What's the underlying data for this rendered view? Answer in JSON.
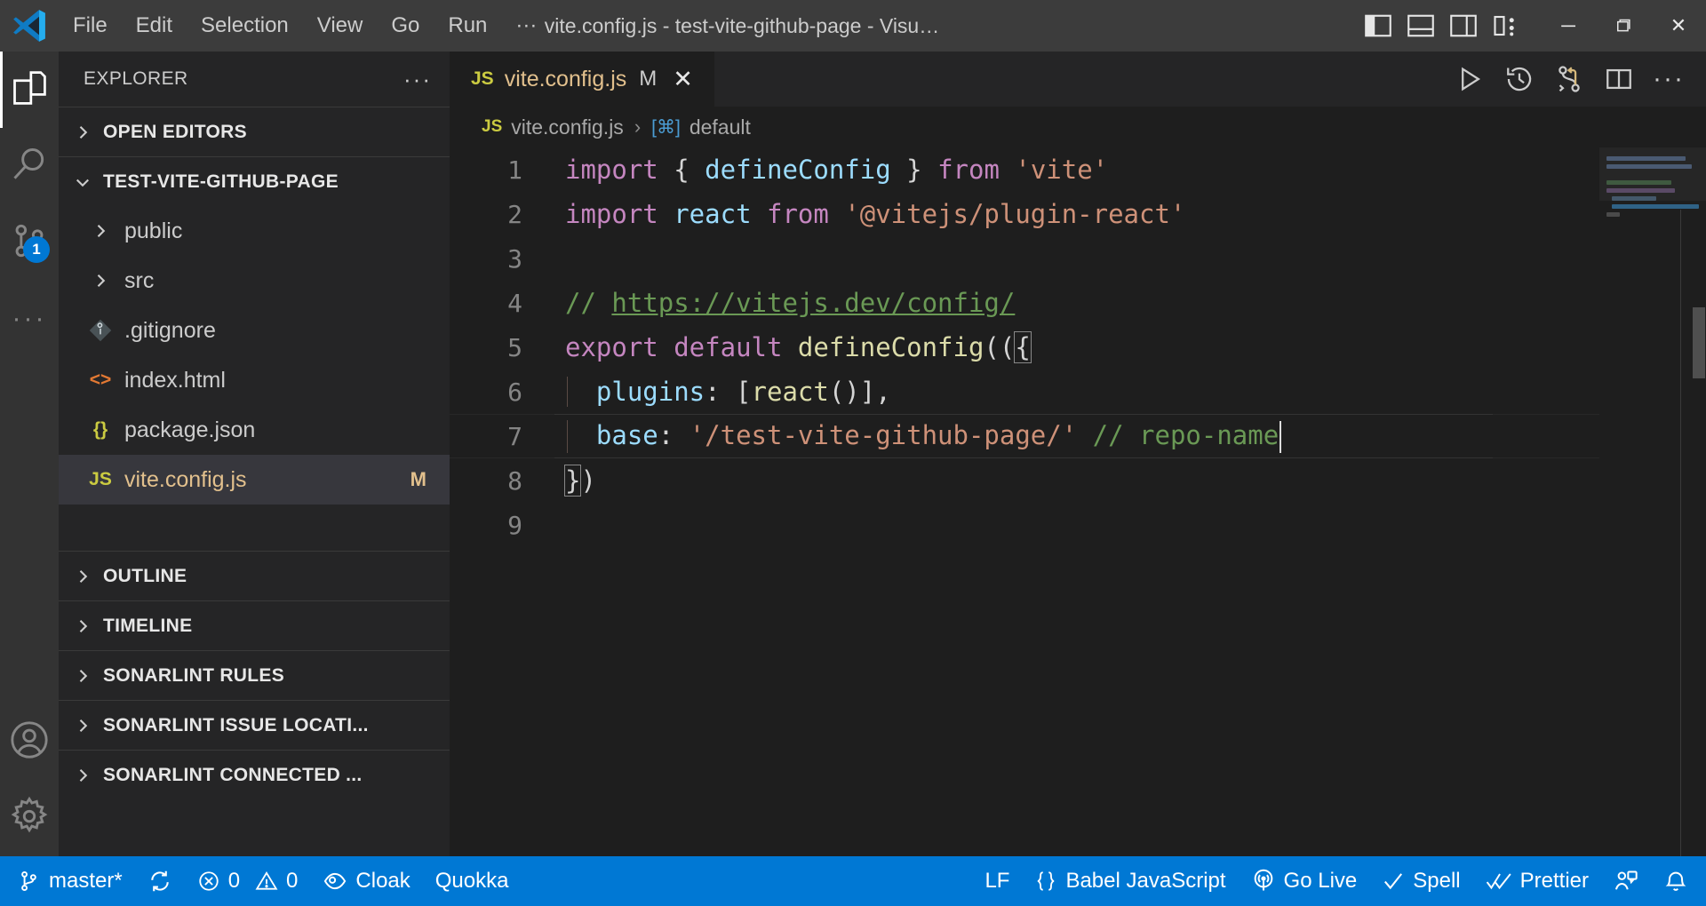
{
  "window": {
    "title": "vite.config.js - test-vite-github-page - Visu…",
    "minimize_label": "─",
    "maximize_label": "❐",
    "close_label": "✕"
  },
  "menu": {
    "items": [
      {
        "label": "File"
      },
      {
        "label": "Edit"
      },
      {
        "label": "Selection"
      },
      {
        "label": "View"
      },
      {
        "label": "Go"
      },
      {
        "label": "Run"
      },
      {
        "label": "···"
      }
    ]
  },
  "layout_buttons": [
    {
      "name": "toggle-primary-sidebar",
      "label": "Toggle Primary Side Bar"
    },
    {
      "name": "toggle-panel",
      "label": "Toggle Panel"
    },
    {
      "name": "toggle-secondary-sidebar",
      "label": "Toggle Secondary Side Bar"
    },
    {
      "name": "customize-layout",
      "label": "Customize Layout"
    }
  ],
  "activitybar": {
    "items": [
      {
        "name": "explorer",
        "label": "Explorer",
        "active": true,
        "badge": ""
      },
      {
        "name": "search",
        "label": "Search",
        "active": false,
        "badge": ""
      },
      {
        "name": "source-control",
        "label": "Source Control",
        "active": false,
        "badge": "1"
      },
      {
        "name": "more-views",
        "label": "Additional Views",
        "active": false,
        "badge": ""
      }
    ],
    "bottom_items": [
      {
        "name": "accounts",
        "label": "Accounts"
      },
      {
        "name": "manage",
        "label": "Manage"
      }
    ]
  },
  "sidebar": {
    "header": "EXPLORER",
    "header_actions": "···",
    "sections": [
      {
        "label": "OPEN EDITORS",
        "expanded": false
      },
      {
        "label": "TEST-VITE-GITHUB-PAGE",
        "expanded": true
      },
      {
        "label": "OUTLINE",
        "expanded": false
      },
      {
        "label": "TIMELINE",
        "expanded": false
      },
      {
        "label": "SONARLINT RULES",
        "expanded": false
      },
      {
        "label": "SONARLINT ISSUE LOCATI...",
        "expanded": false
      },
      {
        "label": "SONARLINT CONNECTED ...",
        "expanded": false
      }
    ],
    "tree": [
      {
        "name": "public",
        "type": "folder",
        "icon": "chevron-right-icon",
        "icon_text": "",
        "badge": "",
        "selected": false
      },
      {
        "name": "src",
        "type": "folder",
        "icon": "chevron-right-icon",
        "icon_text": "",
        "badge": "",
        "selected": false
      },
      {
        "name": ".gitignore",
        "type": "file",
        "icon": "git-icon",
        "icon_text": "◆",
        "badge": "",
        "selected": false
      },
      {
        "name": "index.html",
        "type": "file",
        "icon": "html-icon",
        "icon_text": "<>",
        "badge": "",
        "selected": false
      },
      {
        "name": "package.json",
        "type": "file",
        "icon": "json-icon",
        "icon_text": "{}",
        "badge": "",
        "selected": false
      },
      {
        "name": "vite.config.js",
        "type": "file",
        "icon": "js-icon",
        "icon_text": "JS",
        "badge": "M",
        "selected": true
      }
    ]
  },
  "editor": {
    "tab": {
      "icon_text": "JS",
      "label": "vite.config.js",
      "modified_badge": "M",
      "close_label": "✕"
    },
    "actions": [
      {
        "name": "run-code",
        "label": "Run Code"
      },
      {
        "name": "timeline-history",
        "label": "Open Timeline"
      },
      {
        "name": "compare-changes",
        "label": "Open Changes"
      },
      {
        "name": "split-editor",
        "label": "Split Editor Right"
      },
      {
        "name": "more-actions",
        "label": "More Actions..."
      }
    ],
    "breadcrumb": {
      "file_icon_text": "JS",
      "file": "vite.config.js",
      "separator": "›",
      "symbol_icon": "[⌘]",
      "symbol": "default"
    },
    "lines": [
      {
        "n": "1",
        "modified": false,
        "current": false
      },
      {
        "n": "2",
        "modified": false,
        "current": false
      },
      {
        "n": "3",
        "modified": false,
        "current": false
      },
      {
        "n": "4",
        "modified": false,
        "current": false
      },
      {
        "n": "5",
        "modified": false,
        "current": false
      },
      {
        "n": "6",
        "modified": true,
        "current": false
      },
      {
        "n": "7",
        "modified": true,
        "current": true
      },
      {
        "n": "8",
        "modified": false,
        "current": false
      },
      {
        "n": "9",
        "modified": false,
        "current": false
      }
    ],
    "code": {
      "l1_import": "import",
      "l1_brace_open": " { ",
      "l1_defineConfig": "defineConfig",
      "l1_brace_close": " } ",
      "l1_from": "from",
      "l1_module": " 'vite'",
      "l2_import": "import",
      "l2_react": " react ",
      "l2_from": "from",
      "l2_module": " '@vitejs/plugin-react'",
      "l4_slashes": "// ",
      "l4_url": "https://vitejs.dev/config/",
      "l5_export": "export",
      "l5_default": " default ",
      "l5_defineConfig": "defineConfig",
      "l5_paren": "((",
      "l5_brace": "{",
      "l6_key": "  plugins",
      "l6_colon": ": [",
      "l6_fn": "react",
      "l6_tail": "()],",
      "l7_key": "  base",
      "l7_colon": ": ",
      "l7_value": "'/test-vite-github-page/'",
      "l7_comment": " // repo-name",
      "l8_brace": "}",
      "l8_paren": ")"
    }
  },
  "statusbar": {
    "left": [
      {
        "name": "branch",
        "icon": "source-control-icon",
        "label": "master*"
      },
      {
        "name": "sync",
        "icon": "sync-icon",
        "label": ""
      },
      {
        "name": "problems",
        "icon": "error-warning-icon",
        "label": "0",
        "label2": "0"
      },
      {
        "name": "cloak",
        "icon": "eye-icon",
        "label": "Cloak"
      },
      {
        "name": "quokka",
        "icon": "",
        "label": "Quokka"
      }
    ],
    "right": [
      {
        "name": "eol",
        "icon": "",
        "label": "LF"
      },
      {
        "name": "language-mode",
        "icon": "braces-icon",
        "label": "Babel JavaScript"
      },
      {
        "name": "go-live",
        "icon": "broadcast-icon",
        "label": "Go Live"
      },
      {
        "name": "spell-checker",
        "icon": "check-icon",
        "label": "Spell"
      },
      {
        "name": "prettier",
        "icon": "double-check-icon",
        "label": "Prettier"
      },
      {
        "name": "remote-share",
        "icon": "live-share-icon",
        "label": ""
      },
      {
        "name": "notifications",
        "icon": "bell-icon",
        "label": ""
      }
    ]
  },
  "colors": {
    "accent": "#0078d4",
    "editor_bg": "#1e1e1e",
    "sidebar_bg": "#252526",
    "titlebar_bg": "#3c3c3c",
    "activitybar_bg": "#333333",
    "modified_file": "#e2c08d",
    "badge_bg": "#0078d4"
  }
}
